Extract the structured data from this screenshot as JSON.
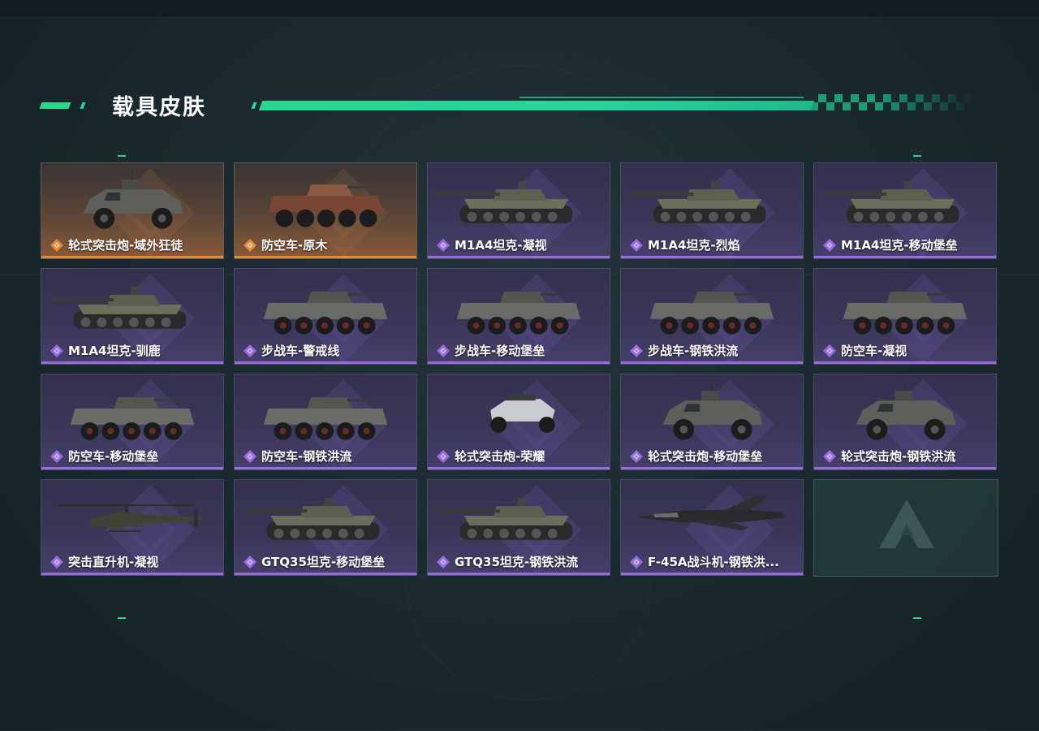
{
  "header": {
    "title": "载具皮肤"
  },
  "colors": {
    "accent": "#2bd68f",
    "epic": "#9a6be0",
    "legendary": "#e08a3c"
  },
  "skins": [
    {
      "label": "轮式突击炮-域外狂徒",
      "rarity": "legendary",
      "vehicle": "armored-car"
    },
    {
      "label": "防空车-原木",
      "rarity": "legendary",
      "vehicle": "ifv-turret"
    },
    {
      "label": "M1A4坦克-凝视",
      "rarity": "epic",
      "vehicle": "tank"
    },
    {
      "label": "M1A4坦克-烈焰",
      "rarity": "epic",
      "vehicle": "tank"
    },
    {
      "label": "M1A4坦克-移动堡垒",
      "rarity": "epic",
      "vehicle": "tank"
    },
    {
      "label": "M1A4坦克-驯鹿",
      "rarity": "epic",
      "vehicle": "tank"
    },
    {
      "label": "步战车-警戒线",
      "rarity": "epic",
      "vehicle": "ifv"
    },
    {
      "label": "步战车-移动堡垒",
      "rarity": "epic",
      "vehicle": "ifv"
    },
    {
      "label": "步战车-钢铁洪流",
      "rarity": "epic",
      "vehicle": "ifv"
    },
    {
      "label": "防空车-凝视",
      "rarity": "epic",
      "vehicle": "ifv"
    },
    {
      "label": "防空车-移动堡垒",
      "rarity": "epic",
      "vehicle": "ifv"
    },
    {
      "label": "防空车-钢铁洪流",
      "rarity": "epic",
      "vehicle": "ifv"
    },
    {
      "label": "轮式突击炮-荣耀",
      "rarity": "epic",
      "vehicle": "buggy"
    },
    {
      "label": "轮式突击炮-移动堡垒",
      "rarity": "epic",
      "vehicle": "armored-car"
    },
    {
      "label": "轮式突击炮-钢铁洪流",
      "rarity": "epic",
      "vehicle": "armored-car"
    },
    {
      "label": "突击直升机-凝视",
      "rarity": "epic",
      "vehicle": "helicopter"
    },
    {
      "label": "GTQ35坦克-移动堡垒",
      "rarity": "epic",
      "vehicle": "tank"
    },
    {
      "label": "GTQ35坦克-钢铁洪流",
      "rarity": "epic",
      "vehicle": "tank"
    },
    {
      "label": "F-45A战斗机-钢铁洪...",
      "rarity": "epic",
      "vehicle": "jet"
    }
  ],
  "empty_slot": {
    "icon": "game-logo-icon"
  }
}
